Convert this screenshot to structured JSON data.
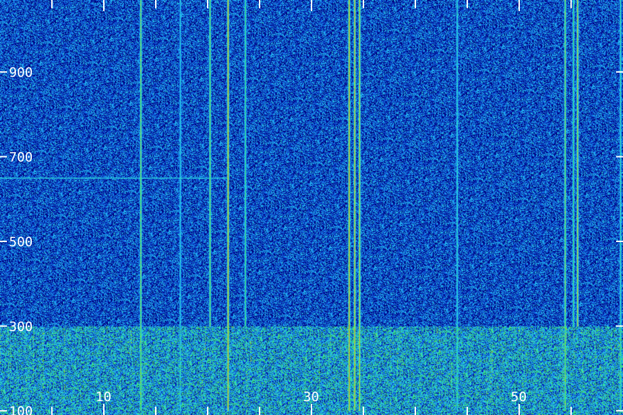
{
  "chart_data": {
    "type": "heatmap",
    "title": "",
    "xlabel": "",
    "ylabel": "",
    "x_ticks": [
      10,
      30,
      50
    ],
    "x_tick_labels": [
      "10",
      "30",
      "50"
    ],
    "xlim": [
      0,
      60
    ],
    "x_minor_step": 5,
    "y_ticks": [
      900,
      700,
      500,
      300,
      100
    ],
    "y_tick_labels": [
      "900",
      "700",
      "500",
      "300",
      "100"
    ],
    "ylim": [
      90,
      1070
    ],
    "grid": false,
    "colormap": [
      "#00007a",
      "#0a3fd0",
      "#1fa8ff",
      "#2fe6c8",
      "#3ed84a",
      "#d8d020",
      "#ff7a10"
    ],
    "axis_color": "#ffffff",
    "noise": {
      "base_level": 0.18,
      "band_upper_level": 0.36,
      "band_y_range": [
        100,
        300
      ]
    },
    "vertical_lines": [
      {
        "x": 13.5,
        "intensity": 0.72,
        "y_range": [
          100,
          1070
        ]
      },
      {
        "x": 17.3,
        "intensity": 0.45,
        "y_range": [
          100,
          1070
        ]
      },
      {
        "x": 20.2,
        "intensity": 0.7,
        "y_range": [
          300,
          1070
        ]
      },
      {
        "x": 21.9,
        "intensity": 0.95,
        "y_range": [
          100,
          1070
        ]
      },
      {
        "x": 23.6,
        "intensity": 0.62,
        "y_range": [
          300,
          1070
        ]
      },
      {
        "x": 33.6,
        "intensity": 0.95,
        "y_range": [
          100,
          1070
        ]
      },
      {
        "x": 34.1,
        "intensity": 0.9,
        "y_range": [
          100,
          1070
        ]
      },
      {
        "x": 34.6,
        "intensity": 0.85,
        "y_range": [
          100,
          1070
        ]
      },
      {
        "x": 44.0,
        "intensity": 0.5,
        "y_range": [
          100,
          1070
        ]
      },
      {
        "x": 54.4,
        "intensity": 0.72,
        "y_range": [
          100,
          1070
        ]
      },
      {
        "x": 55.2,
        "intensity": 0.62,
        "y_range": [
          300,
          1070
        ]
      },
      {
        "x": 55.6,
        "intensity": 0.82,
        "y_range": [
          300,
          1070
        ]
      },
      {
        "x": 59.7,
        "intensity": 0.55,
        "y_range": [
          100,
          1070
        ]
      }
    ],
    "horizontal_lines": [
      {
        "y": 650,
        "x_range": [
          0,
          21.9
        ],
        "intensity": 0.5
      }
    ]
  }
}
